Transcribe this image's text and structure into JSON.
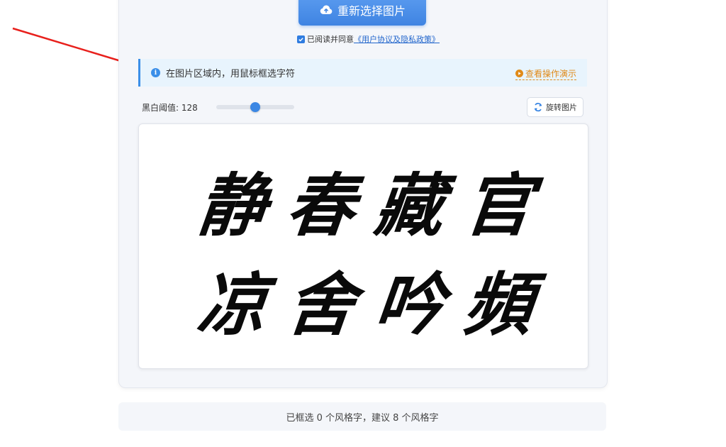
{
  "upload": {
    "reselect_label": "重新选择图片"
  },
  "agreement": {
    "prefix": "已阅读并同意",
    "link": "《用户协议及隐私政策》",
    "checked": true
  },
  "tip": {
    "text": "在图片区域内，用鼠标框选字符",
    "demo_label": "查看操作演示"
  },
  "threshold": {
    "label": "黑白阈值: 128",
    "value": 128,
    "min": 0,
    "max": 255
  },
  "rotate": {
    "label": "旋转图片"
  },
  "characters": [
    "静",
    "春",
    "藏",
    "官",
    "凉",
    "舍",
    "吟",
    "頻"
  ],
  "status": {
    "text": "已框选 0 个风格字，建议 8 个风格字"
  },
  "colors": {
    "accent": "#3f84e2",
    "tip_bg": "#e8f4fd",
    "demo": "#e08a18",
    "arrow": "#e8201c"
  }
}
